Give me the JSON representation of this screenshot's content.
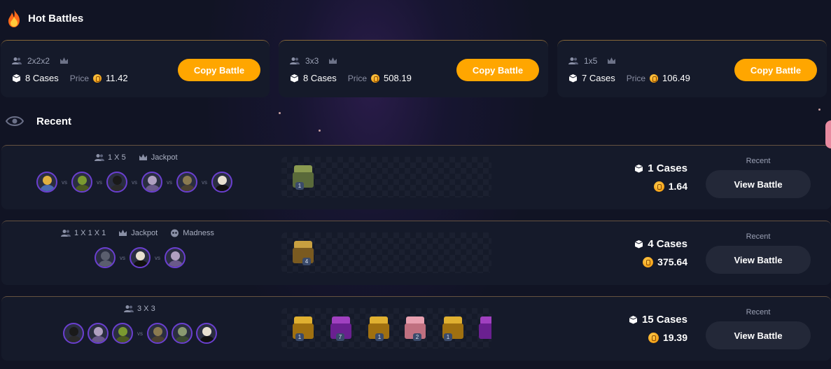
{
  "hot_battles": {
    "title": "Hot Battles",
    "cards": [
      {
        "mode": "2x2x2",
        "cases": "8 Cases",
        "price_label": "Price",
        "price": "11.42",
        "button": "Copy Battle"
      },
      {
        "mode": "3x3",
        "cases": "8 Cases",
        "price_label": "Price",
        "price": "508.19",
        "button": "Copy Battle"
      },
      {
        "mode": "1x5",
        "cases": "7 Cases",
        "price_label": "Price",
        "price": "106.49",
        "button": "Copy Battle"
      }
    ]
  },
  "recent": {
    "title": "Recent",
    "battles": [
      {
        "mode": "1 X 5",
        "tags": [
          "Jackpot"
        ],
        "vs_label": "vs",
        "cases": "1 Cases",
        "price": "1.64",
        "status": "Recent",
        "button": "View Battle",
        "case_counts": [
          "1"
        ]
      },
      {
        "mode": "1 X 1 X 1",
        "tags": [
          "Jackpot",
          "Madness"
        ],
        "vs_label": "vs",
        "cases": "4 Cases",
        "price": "375.64",
        "status": "Recent",
        "button": "View Battle",
        "case_counts": [
          "4"
        ]
      },
      {
        "mode": "3 X 3",
        "tags": [],
        "vs_label": "vs",
        "cases": "15 Cases",
        "price": "19.39",
        "status": "Recent",
        "button": "View Battle",
        "case_counts": [
          "1",
          "7",
          "1",
          "2",
          "1",
          ""
        ]
      }
    ]
  },
  "colors": {
    "accent": "#ffa600",
    "avatar_ring": "#6a3fd0",
    "card_bg": "#151a2a"
  },
  "icons": [
    "fire-icon",
    "eye-icon",
    "user-icon",
    "crown-icon",
    "case-box-icon",
    "coin-icon",
    "skull-icon"
  ]
}
